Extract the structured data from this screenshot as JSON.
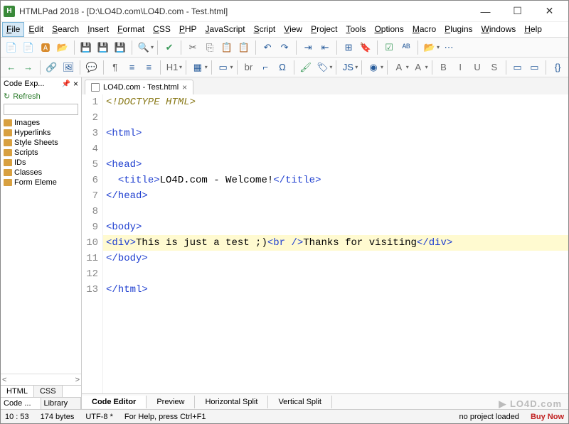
{
  "window": {
    "app_icon_letter": "H",
    "title": "HTMLPad 2018 - [D:\\LO4D.com\\LO4D.com - Test.html]",
    "min_icon": "—",
    "max_icon": "☐",
    "close_icon": "✕"
  },
  "menu": [
    "File",
    "Edit",
    "Search",
    "Insert",
    "Format",
    "CSS",
    "PHP",
    "JavaScript",
    "Script",
    "View",
    "Project",
    "Tools",
    "Options",
    "Macro",
    "Plugins",
    "Windows",
    "Help"
  ],
  "sidebar": {
    "panel_title": "Code Exp...",
    "pin": "📌",
    "close": "×",
    "refresh_label": "Refresh",
    "search_placeholder": "",
    "items": [
      "Images",
      "Hyperlinks",
      "Style Sheets",
      "Scripts",
      "IDs",
      "Classes",
      "Form Eleme"
    ],
    "scroll_left": "<",
    "scroll_right": ">",
    "tabs": [
      "HTML",
      "CSS"
    ],
    "bottom_tabs": [
      "Code ...",
      "Library"
    ]
  },
  "filetab": {
    "label": "LO4D.com - Test.html",
    "close": "×"
  },
  "code_lines": [
    {
      "n": 1,
      "segments": [
        {
          "cls": "kw-doctype",
          "text": "<!DOCTYPE HTML>"
        }
      ]
    },
    {
      "n": 2,
      "segments": []
    },
    {
      "n": 3,
      "segments": [
        {
          "cls": "kw-tag",
          "text": "<html>"
        }
      ]
    },
    {
      "n": 4,
      "segments": []
    },
    {
      "n": 5,
      "segments": [
        {
          "cls": "kw-tag",
          "text": "<head>"
        }
      ]
    },
    {
      "n": 6,
      "segments": [
        {
          "cls": "kw-text",
          "text": "  "
        },
        {
          "cls": "kw-tag",
          "text": "<title>"
        },
        {
          "cls": "kw-text",
          "text": "LO4D.com - Welcome!"
        },
        {
          "cls": "kw-tag",
          "text": "</title>"
        }
      ]
    },
    {
      "n": 7,
      "segments": [
        {
          "cls": "kw-tag",
          "text": "</head>"
        }
      ]
    },
    {
      "n": 8,
      "segments": []
    },
    {
      "n": 9,
      "segments": [
        {
          "cls": "kw-tag",
          "text": "<body>"
        }
      ]
    },
    {
      "n": 10,
      "hl": true,
      "segments": [
        {
          "cls": "kw-tag",
          "text": "<div>"
        },
        {
          "cls": "kw-text",
          "text": "This is just a test ;)"
        },
        {
          "cls": "kw-tag",
          "text": "<br />"
        },
        {
          "cls": "kw-text",
          "text": "Thanks for visiting"
        },
        {
          "cls": "kw-tag",
          "text": "</div>"
        }
      ]
    },
    {
      "n": 11,
      "segments": [
        {
          "cls": "kw-tag",
          "text": "</body>"
        }
      ]
    },
    {
      "n": 12,
      "segments": []
    },
    {
      "n": 13,
      "segments": [
        {
          "cls": "kw-tag",
          "text": "</html>"
        }
      ]
    }
  ],
  "view_tabs": [
    "Code Editor",
    "Preview",
    "Horizontal Split",
    "Vertical Split"
  ],
  "status": {
    "pos": "10 : 53",
    "size": "174 bytes",
    "encoding": "UTF-8 *",
    "help": "For Help, press Ctrl+F1",
    "project": "no project loaded",
    "buy": "Buy Now"
  },
  "watermark": "▶ LO4D.com",
  "toolbar1_icons": [
    "new-doc",
    "new-doc-alt",
    "doc-red",
    "open-folder",
    "sep",
    "save",
    "save-all",
    "save-as",
    "sep",
    "search",
    "dropdown",
    "sep",
    "spellcheck",
    "sep",
    "cut",
    "copy",
    "paste",
    "paste-special",
    "sep",
    "undo",
    "redo",
    "sep",
    "indent",
    "outdent",
    "sep",
    "toggle",
    "bookmark",
    "sep",
    "validate",
    "autocomplete",
    "sep",
    "open-recent",
    "dropdown",
    "ellipsis"
  ],
  "toolbar2_icons": [
    "back",
    "forward",
    "sep",
    "link",
    "image",
    "sep",
    "comment",
    "sep",
    "pilcrow",
    "list-ul",
    "list-ol",
    "sep",
    "heading",
    "dropdown",
    "sep",
    "table",
    "dropdown",
    "sep",
    "form",
    "dropdown",
    "sep",
    "text-br",
    "corner",
    "omega",
    "sep",
    "paint",
    "tag",
    "dropdown",
    "sep",
    "js",
    "dropdown",
    "sep",
    "rgb",
    "dropdown",
    "sep",
    "font-a",
    "dropdown",
    "font-a2",
    "dropdown",
    "sep",
    "bold",
    "italic",
    "underline",
    "strike",
    "sep",
    "btn1",
    "btn2",
    "sep",
    "code-brackets"
  ]
}
